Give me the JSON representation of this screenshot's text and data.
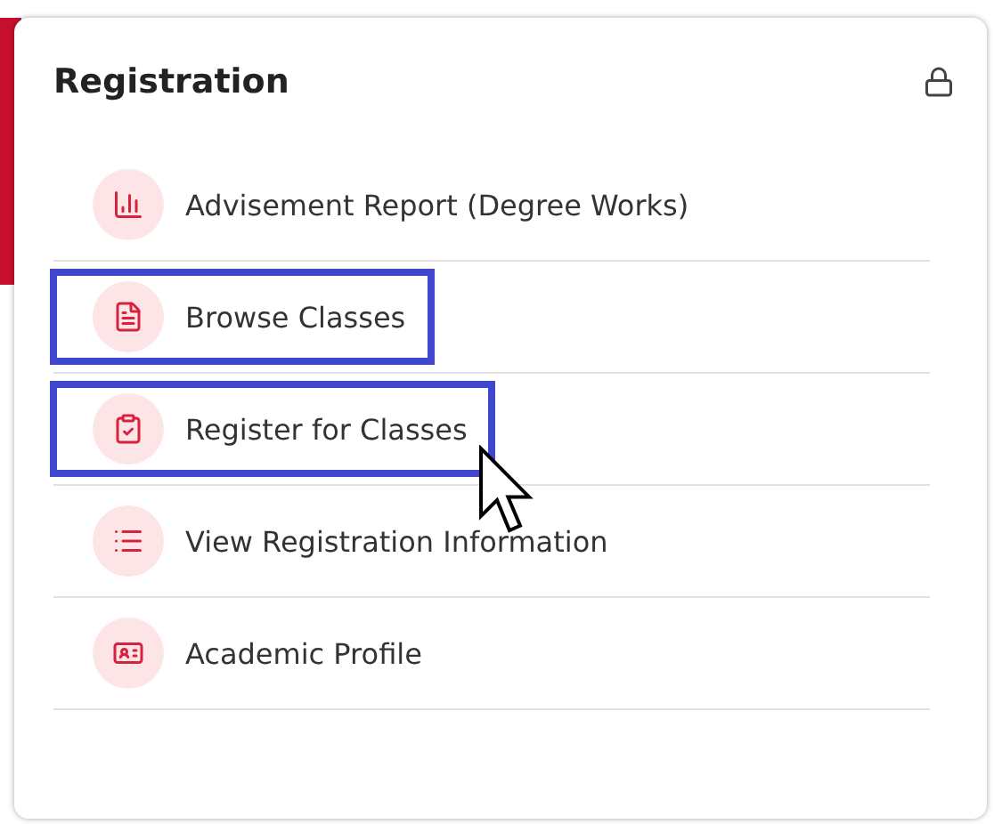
{
  "card": {
    "title": "Registration",
    "locked": true
  },
  "items": [
    {
      "label": "Advisement Report (Degree Works)",
      "kind": "chart",
      "highlighted": false
    },
    {
      "label": "Browse Classes",
      "kind": "document",
      "highlighted": true
    },
    {
      "label": "Register for Classes",
      "kind": "clipboard",
      "highlighted": true
    },
    {
      "label": "View Registration Information",
      "kind": "list",
      "highlighted": false
    },
    {
      "label": "Academic Profile",
      "kind": "idcard",
      "highlighted": false
    }
  ],
  "cursor": {
    "visible": true
  }
}
